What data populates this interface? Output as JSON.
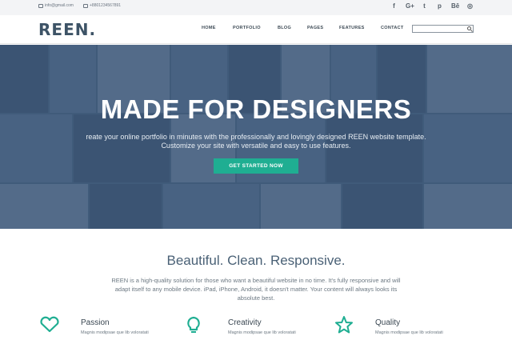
{
  "topbar": {
    "email": "info@gmail.com",
    "phone": "+8801234567891",
    "socials": [
      {
        "icon": "facebook-icon",
        "glyph": "f"
      },
      {
        "icon": "google-plus-icon",
        "glyph": "G+"
      },
      {
        "icon": "twitter-icon",
        "glyph": "t"
      },
      {
        "icon": "pinterest-icon",
        "glyph": "p"
      },
      {
        "icon": "behance-icon",
        "glyph": "Bē"
      },
      {
        "icon": "dribbble-icon",
        "glyph": "◎"
      }
    ]
  },
  "nav": {
    "logo": "REEN.",
    "items": [
      "HOME",
      "PORTFOLIO",
      "BLOG",
      "PAGES",
      "FEATURES",
      "CONTACT"
    ],
    "search_placeholder": ""
  },
  "hero": {
    "title": "MADE FOR DESIGNERS",
    "subtitle_line1": "reate your online portfolio in minutes with the professionally and lovingly designed REEN website template.",
    "subtitle_line2": "Customize your site with versatile and easy to use features.",
    "cta_label": "GET STARTED NOW"
  },
  "intro": {
    "heading": "Beautiful. Clean. Responsive.",
    "body": "REEN is a high-quality solution for those who want a beautiful website in no time. It's fully responsive and will adapt itself to any mobile device. iPad, iPhone, Android, it doesn't matter. Your content will always looks its absolute best."
  },
  "features": [
    {
      "icon": "heart-icon",
      "title": "Passion",
      "desc": "Magnis modipsae que lib voloratati"
    },
    {
      "icon": "lightbulb-icon",
      "title": "Creativity",
      "desc": "Magnis modipsae que lib voloratati"
    },
    {
      "icon": "star-icon",
      "title": "Quality",
      "desc": "Magnis modipsae que lib voloratati"
    }
  ],
  "colors": {
    "accent": "#1fae92",
    "logo": "#3d5366",
    "hero_overlay": "#4b6684"
  }
}
